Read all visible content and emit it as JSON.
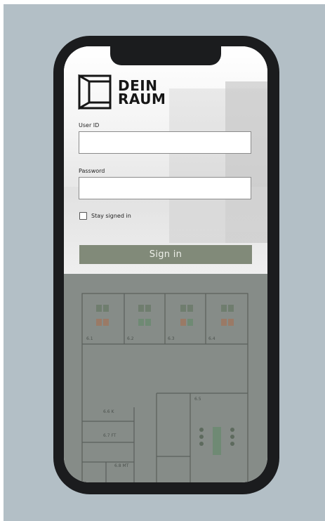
{
  "brand": {
    "line1": "DEIN",
    "line2": "RAUM",
    "logo_icon": "door-frame-logo"
  },
  "login": {
    "user_id_label": "User ID",
    "user_id_value": "",
    "password_label": "Password",
    "password_value": "",
    "remember_label": "Stay signed in",
    "remember_checked": false,
    "sign_in_label": "Sign in"
  },
  "floorplan": {
    "rooms": [
      "6.1",
      "6.2",
      "6.3",
      "6.4",
      "6.5",
      "6.6 K",
      "6.7 FT",
      "6.8 MT"
    ]
  },
  "colors": {
    "background": "#b3bfc6",
    "phone_frame": "#1b1c1e",
    "button": "#818a79",
    "plan_overlay": "#868c88"
  }
}
